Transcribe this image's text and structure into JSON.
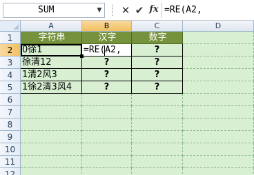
{
  "formula_bar": {
    "name_box": "SUM",
    "name_box_arrow_icon": "dropdown-arrow",
    "cancel_icon": "✕",
    "enter_icon": "✔",
    "fx_label": "fx",
    "formula": "=RE(A2,"
  },
  "columns": [
    "A",
    "B",
    "C",
    "D"
  ],
  "rows": [
    "1",
    "2",
    "3",
    "4",
    "5",
    "6",
    "7",
    "8",
    "9",
    "10",
    "11",
    "12"
  ],
  "table": {
    "headers": [
      "字符串",
      "汉字",
      "数字"
    ],
    "rows": [
      [
        "0徐1",
        "=RE(A2,",
        "?"
      ],
      [
        "徐清12",
        "?",
        "?"
      ],
      [
        "1清2风3",
        "?",
        "?"
      ],
      [
        "1徐2清3风4",
        "?",
        "?"
      ]
    ]
  },
  "colors": {
    "header_fill": "#76923c",
    "sheet_fill": "#d8efd2",
    "selected_header": "#f1c15f"
  }
}
